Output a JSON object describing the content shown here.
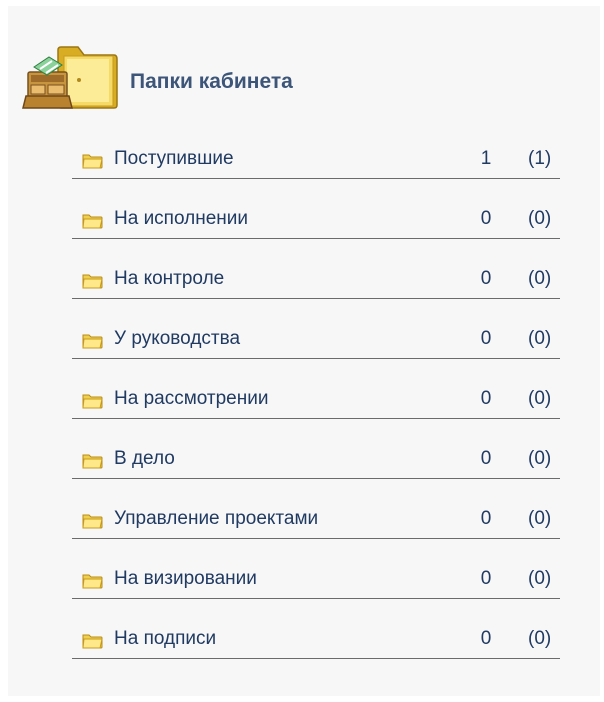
{
  "panel": {
    "title": "Папки кабинета",
    "title_icon": "cabinet-folder-icon",
    "folder_icon": "folder-icon",
    "colors": {
      "background": "#f7f7f7",
      "title": "#3c5578",
      "link": "#203a62",
      "underline": "#6b6b6b",
      "folder": "#f2d45c"
    }
  },
  "folders": [
    {
      "name": "Поступившие",
      "count": "1",
      "total": "(1)"
    },
    {
      "name": "На исполнении",
      "count": "0",
      "total": "(0)"
    },
    {
      "name": "На контроле",
      "count": "0",
      "total": "(0)"
    },
    {
      "name": "У руководства",
      "count": "0",
      "total": "(0)"
    },
    {
      "name": "На рассмотрении",
      "count": "0",
      "total": "(0)"
    },
    {
      "name": "В дело",
      "count": "0",
      "total": "(0)"
    },
    {
      "name": "Управление проектами",
      "count": "0",
      "total": "(0)"
    },
    {
      "name": "На визировании",
      "count": "0",
      "total": "(0)"
    },
    {
      "name": "На подписи",
      "count": "0",
      "total": "(0)"
    }
  ]
}
